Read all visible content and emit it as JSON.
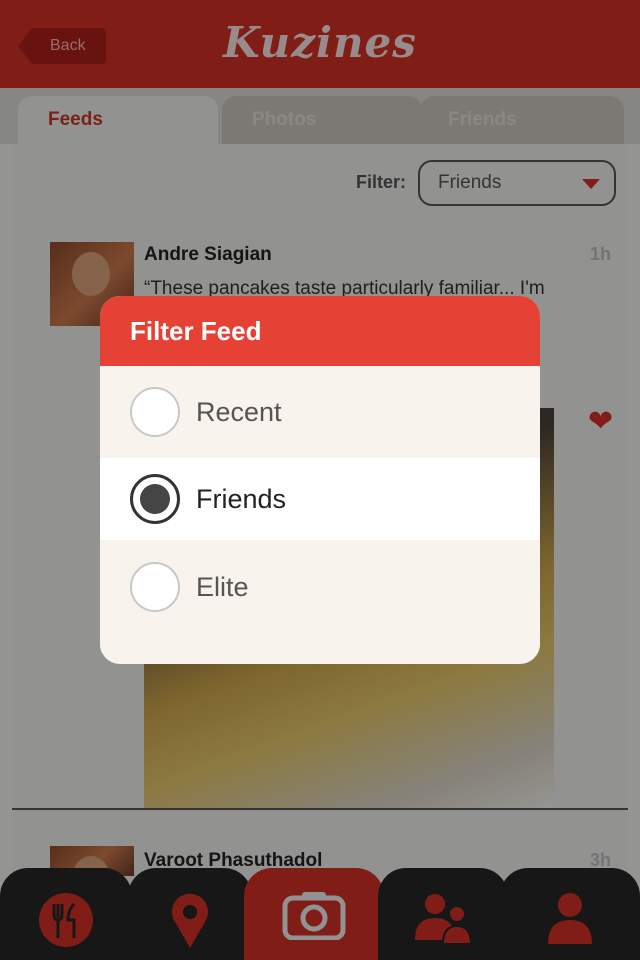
{
  "header": {
    "back_label": "Back",
    "logo": "Kuzines"
  },
  "tabs": [
    {
      "label": "Feeds",
      "active": true
    },
    {
      "label": "Photos",
      "active": false
    },
    {
      "label": "Friends",
      "active": false
    }
  ],
  "filter": {
    "label": "Filter:",
    "value": "Friends"
  },
  "posts": [
    {
      "name": "Andre Siagian",
      "time": "1h",
      "text": "“These pancakes taste particularly familiar... I'm"
    },
    {
      "name": "Varoot Phasuthadol",
      "time": "3h"
    }
  ],
  "modal": {
    "title": "Filter Feed",
    "options": [
      {
        "label": "Recent",
        "selected": false
      },
      {
        "label": "Friends",
        "selected": true
      },
      {
        "label": "Elite",
        "selected": false
      }
    ]
  },
  "nav": [
    {
      "icon": "restaurant-icon",
      "active": false
    },
    {
      "icon": "location-pin-icon",
      "active": false
    },
    {
      "icon": "camera-icon",
      "active": true
    },
    {
      "icon": "friends-icon",
      "active": false
    },
    {
      "icon": "profile-icon",
      "active": false
    }
  ],
  "colors": {
    "brand_red": "#cf2f24",
    "modal_header": "#e54235",
    "nav_dark": "#262626"
  }
}
